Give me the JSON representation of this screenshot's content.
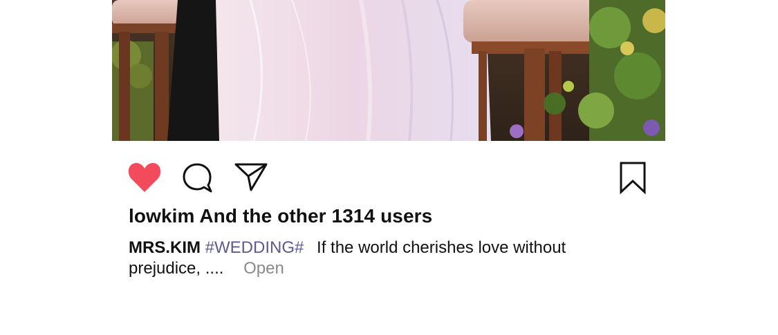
{
  "post": {
    "image_description_icon": "wedding-photo",
    "likes_text": "lowkim And the other 1314 users",
    "caption": {
      "author": "MRS.KIM",
      "hashtag": "#WEDDING#",
      "text": "If the world cherishes love without prejudice, ....",
      "more_label": "Open"
    },
    "actions": {
      "like_icon": "heart-icon",
      "comment_icon": "comment-icon",
      "share_icon": "send-icon",
      "bookmark_icon": "bookmark-icon",
      "liked": true
    }
  },
  "colors": {
    "like_red": "#f24b5b",
    "hashtag": "#5b5b8f",
    "muted": "#8a8a8a",
    "text": "#111111"
  }
}
